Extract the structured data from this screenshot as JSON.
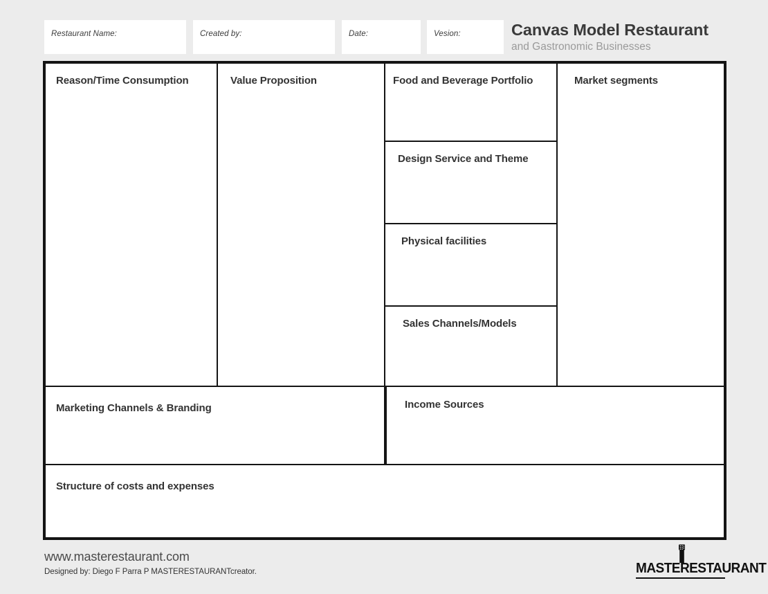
{
  "header": {
    "fields": [
      {
        "id": "restaurant-name",
        "label": "Restaurant Name:",
        "value": ""
      },
      {
        "id": "created-by",
        "label": "Created by:",
        "value": ""
      },
      {
        "id": "date",
        "label": "Date:",
        "value": ""
      },
      {
        "id": "version",
        "label": "Vesion:",
        "value": ""
      }
    ],
    "title": "Canvas Model Restaurant",
    "subtitle": "and Gastronomic Businesses"
  },
  "canvas": {
    "blocks": {
      "reason_time_consumption": "Reason/Time Consumption",
      "value_proposition": "Value Proposition",
      "food_and_beverage_portfolio": "Food and Beverage Portfolio",
      "design_service_and_theme": "Design Service and Theme",
      "physical_facilities": "Physical facilities",
      "sales_channels_models": "Sales Channels/Models",
      "market_segments": "Market segments",
      "marketing_channels_branding": "Marketing Channels & Branding",
      "income_sources": "Income Sources",
      "structure_of_costs_and_expenses": "Structure of costs and expenses"
    }
  },
  "footer": {
    "url": "www.masterestaurant.com",
    "credit": "Designed by: Diego F Parra P MASTERESTAURANTcreator.",
    "logo_text": "MASTERESTAURANT",
    "logo_icon": "pepper-shaker-icon"
  },
  "colors": {
    "background": "#ececec",
    "frame": "#141414",
    "title": "#3a3a3a",
    "subtitle": "#9a9a9a",
    "block_title": "#333333"
  }
}
